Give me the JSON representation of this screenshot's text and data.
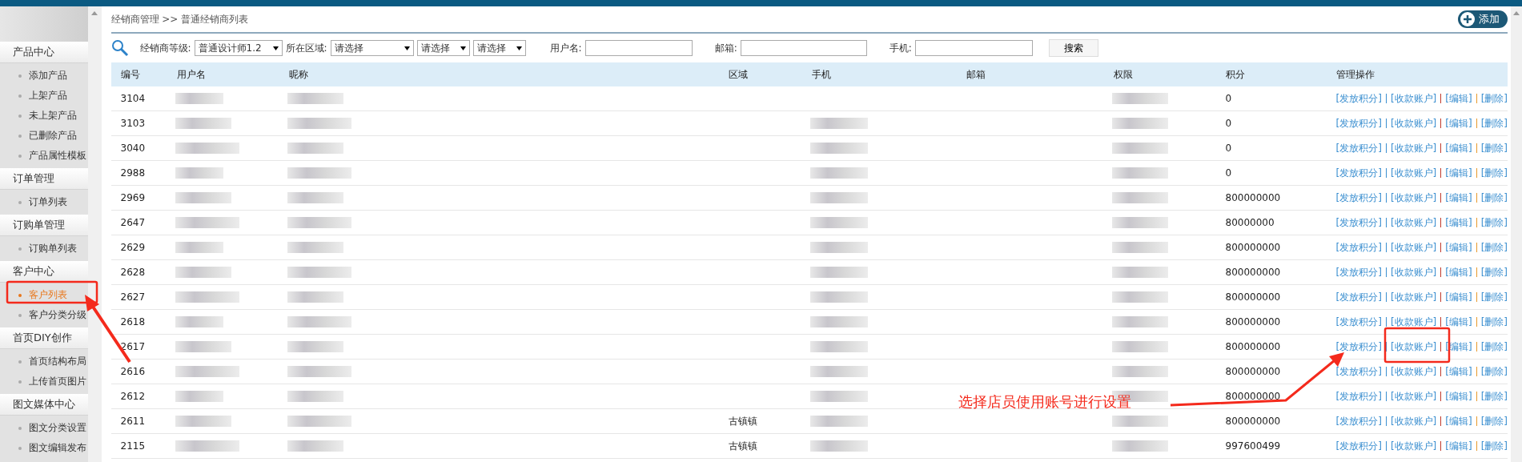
{
  "sidebar": {
    "groups": [
      {
        "title": "产品中心",
        "items": [
          {
            "label": "添加产品",
            "selected": false
          },
          {
            "label": "上架产品",
            "selected": false
          },
          {
            "label": "未上架产品",
            "selected": false
          },
          {
            "label": "已删除产品",
            "selected": false
          },
          {
            "label": "产品属性模板",
            "selected": false
          }
        ]
      },
      {
        "title": "订单管理",
        "items": [
          {
            "label": "订单列表",
            "selected": false
          }
        ]
      },
      {
        "title": "订购单管理",
        "items": [
          {
            "label": "订购单列表",
            "selected": false
          }
        ]
      },
      {
        "title": "客户中心",
        "items": [
          {
            "label": "客户列表",
            "selected": true
          },
          {
            "label": "客户分类分级",
            "selected": false
          }
        ]
      },
      {
        "title": "首页DIY创作",
        "items": [
          {
            "label": "首页结构布局",
            "selected": false
          },
          {
            "label": "上传首页图片",
            "selected": false
          }
        ]
      },
      {
        "title": "图文媒体中心",
        "items": [
          {
            "label": "图文分类设置",
            "selected": false
          },
          {
            "label": "图文编辑发布",
            "selected": false
          }
        ]
      }
    ]
  },
  "breadcrumb": "经销商管理 >> 普通经销商列表",
  "add_button": "添加",
  "filters": {
    "level_label": "经销商等级:",
    "level_value": "普通设计师1.2",
    "region_label": "所在区域:",
    "region_values": [
      "请选择",
      "请选择",
      "请选择"
    ],
    "username_label": "用户名:",
    "email_label": "邮箱:",
    "phone_label": "手机:",
    "search_button": "搜索"
  },
  "table": {
    "columns": [
      "编号",
      "用户名",
      "昵称",
      "区域",
      "手机",
      "邮箱",
      "权限",
      "积分",
      "管理操作"
    ],
    "rows": [
      {
        "id": "3104",
        "region": "",
        "points": "0",
        "phone_hidden": false,
        "actions": [
          "[发放积分]",
          "[收款账户]",
          "[编辑]",
          "[删除]"
        ]
      },
      {
        "id": "3103",
        "region": "",
        "points": "0",
        "phone_hidden": true,
        "actions": [
          "[发放积分]",
          "[收款账户]",
          "[编辑]",
          "[删除]"
        ]
      },
      {
        "id": "3040",
        "region": "",
        "points": "0",
        "phone_hidden": true,
        "actions": [
          "[发放积分]",
          "[收款账户]",
          "[编辑]",
          "[删除]"
        ]
      },
      {
        "id": "2988",
        "region": "",
        "points": "0",
        "phone_hidden": true,
        "actions": [
          "[发放积分]",
          "[收款账户]",
          "[编辑]",
          "[删除]"
        ]
      },
      {
        "id": "2969",
        "region": "",
        "points": "800000000",
        "phone_hidden": true,
        "actions": [
          "[发放积分]",
          "[收款账户]",
          "[编辑]",
          "[删除]"
        ]
      },
      {
        "id": "2647",
        "region": "",
        "points": "80000000",
        "phone_hidden": true,
        "actions": [
          "[发放积分]",
          "[收款账户]",
          "[编辑]",
          "[删除]"
        ]
      },
      {
        "id": "2629",
        "region": "",
        "points": "800000000",
        "phone_hidden": true,
        "actions": [
          "[发放积分]",
          "[收款账户]",
          "[编辑]",
          "[删除]"
        ]
      },
      {
        "id": "2628",
        "region": "",
        "points": "800000000",
        "phone_hidden": true,
        "actions": [
          "[发放积分]",
          "[收款账户]",
          "[编辑]",
          "[删除]"
        ]
      },
      {
        "id": "2627",
        "region": "",
        "points": "800000000",
        "phone_hidden": true,
        "actions": [
          "[发放积分]",
          "[收款账户]",
          "[编辑]",
          "[删除]"
        ]
      },
      {
        "id": "2618",
        "region": "",
        "points": "800000000",
        "phone_hidden": true,
        "actions": [
          "[发放积分]",
          "[收款账户]",
          "[编辑]",
          "[删除]"
        ]
      },
      {
        "id": "2617",
        "region": "",
        "points": "800000000",
        "phone_hidden": true,
        "actions": [
          "[发放积分]",
          "[收款账户]",
          "[编辑]",
          "[删除]"
        ]
      },
      {
        "id": "2616",
        "region": "",
        "points": "800000000",
        "phone_hidden": true,
        "actions": [
          "[发放积分]",
          "[收款账户]",
          "[编辑]",
          "[删除]"
        ]
      },
      {
        "id": "2612",
        "region": "",
        "points": "800000000",
        "phone_hidden": true,
        "actions": [
          "[发放积分]",
          "[收款账户]",
          "[编辑]",
          "[删除]"
        ]
      },
      {
        "id": "2611",
        "region": "古镇镇",
        "points": "800000000",
        "phone_hidden": true,
        "actions": [
          "[发放积分]",
          "[收款账户]",
          "[编辑]",
          "[删除]"
        ]
      },
      {
        "id": "2115",
        "region": "古镇镇",
        "points": "997600499",
        "phone_hidden": true,
        "actions": [
          "[发放积分]",
          "[收款账户]",
          "[编辑]",
          "[删除]"
        ]
      }
    ]
  },
  "annotation": {
    "text": "选择店员使用账号进行设置"
  }
}
